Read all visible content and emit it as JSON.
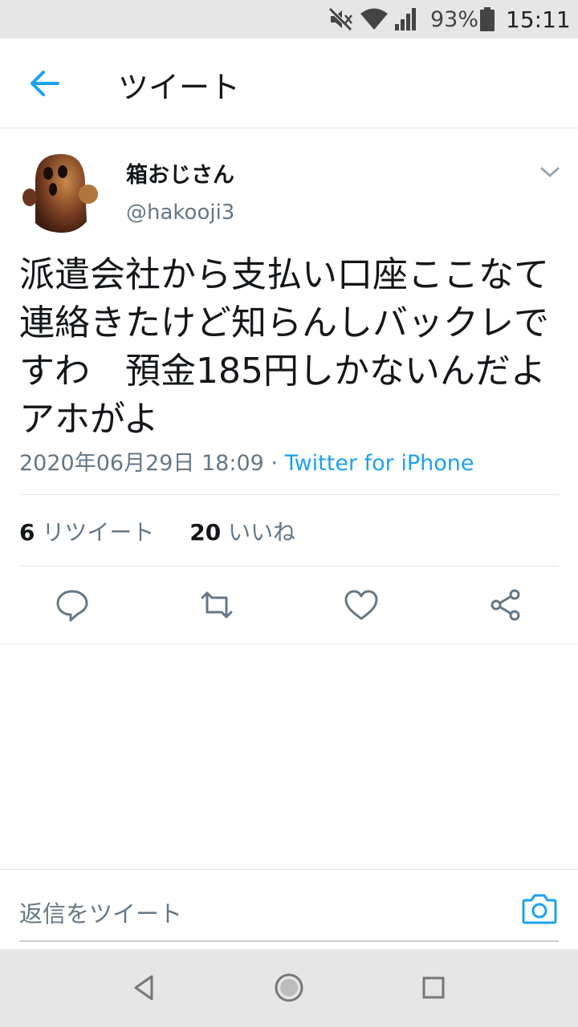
{
  "status_bar": {
    "battery_percent": "93%",
    "time": "15:11",
    "icons": [
      "mute-icon",
      "wifi-icon",
      "signal-icon",
      "battery-icon"
    ]
  },
  "app_bar": {
    "title": "ツイート",
    "back_icon": "arrow-left-icon"
  },
  "tweet": {
    "user_name": "箱おじさん",
    "handle": "@hakooji3",
    "text_lines": [
      "派遣会社から支払い口座ここなて",
      "連絡きたけど知らんしバックレで",
      "すわ　預金185円しかないんだよ",
      "アホがよ"
    ],
    "timestamp": "2020年06月29日 18:09",
    "separator": " · ",
    "source": "Twitter for iPhone",
    "retweet_count": "6",
    "retweet_label": "リツイート",
    "like_count": "20",
    "like_label": "いいね",
    "actions": [
      "reply-icon",
      "retweet-icon",
      "like-icon",
      "share-icon"
    ]
  },
  "reply_composer": {
    "placeholder": "返信をツイート",
    "camera_icon": "camera-icon"
  },
  "colors": {
    "accent": "#1da1f2",
    "text_primary": "#14171a",
    "text_secondary": "#657786",
    "divider": "#e1e8ed",
    "system_bar": "#e6e6e6"
  }
}
